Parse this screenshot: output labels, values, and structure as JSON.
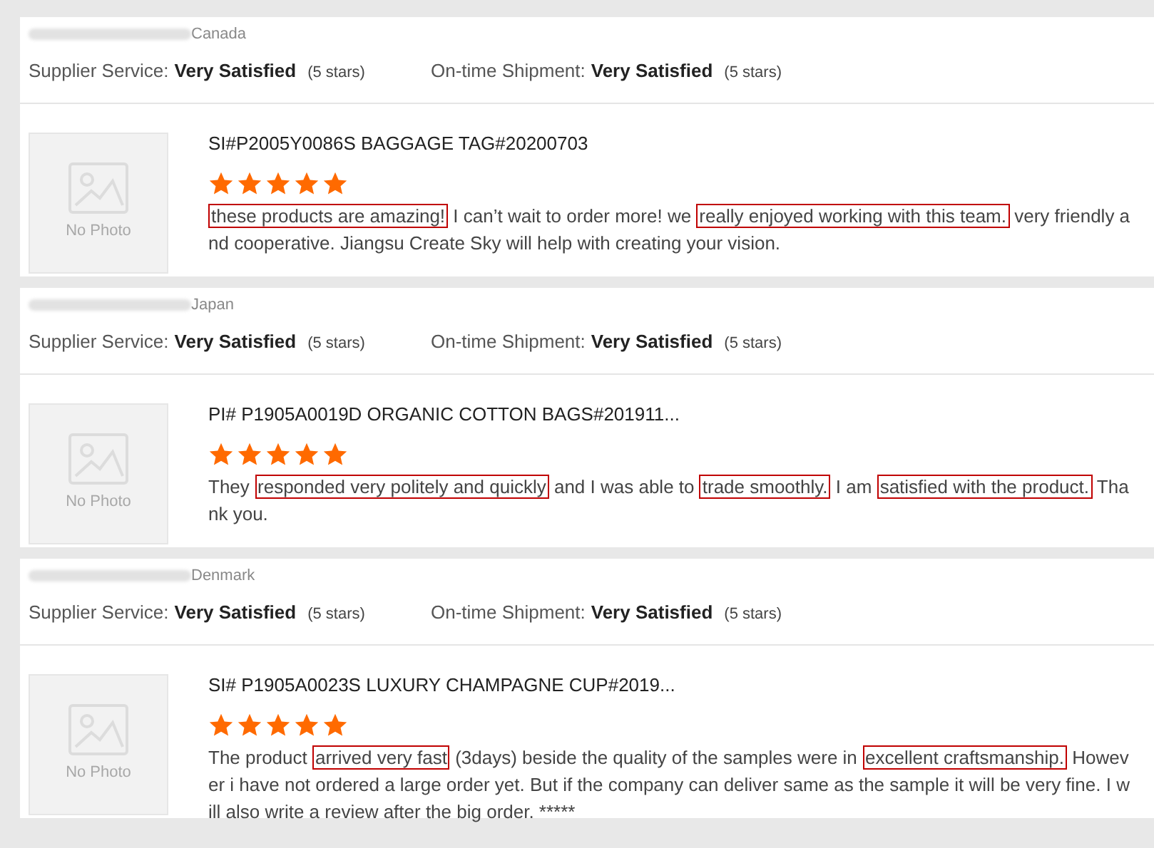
{
  "reviews": [
    {
      "country": "Canada",
      "ratings": [
        {
          "label": "Supplier Service:",
          "value": "Very Satisfied",
          "stars_text": "(5 stars)"
        },
        {
          "label": "On-time Shipment:",
          "value": "Very Satisfied",
          "stars_text": "(5 stars)"
        }
      ],
      "photo_text": "No Photo",
      "product": "SI#P2005Y0086S BAGGAGE TAG#20200703",
      "stars": 5,
      "text": [
        {
          "s": "these products are amazing!",
          "boxed": true
        },
        {
          "s": " I can’t wait to order more! we ",
          "boxed": false
        },
        {
          "s": "really enjoyed working with this team.",
          "boxed": true
        },
        {
          "s": " very friendly and cooperative. Jiangsu Create Sky will help with creating your vision.",
          "boxed": false
        }
      ]
    },
    {
      "country": "Japan",
      "ratings": [
        {
          "label": "Supplier Service:",
          "value": "Very Satisfied",
          "stars_text": "(5 stars)"
        },
        {
          "label": "On-time Shipment:",
          "value": "Very Satisfied",
          "stars_text": "(5 stars)"
        }
      ],
      "photo_text": "No Photo",
      "product": "PI# P1905A0019D ORGANIC COTTON BAGS#201911...",
      "stars": 5,
      "text": [
        {
          "s": "They ",
          "boxed": false
        },
        {
          "s": "responded very politely and quickly",
          "boxed": true
        },
        {
          "s": " and I was able to ",
          "boxed": false
        },
        {
          "s": "trade smoothly.",
          "boxed": true
        },
        {
          "s": " I am ",
          "boxed": false
        },
        {
          "s": "satisfied with the product.",
          "boxed": true
        },
        {
          "s": " Thank you.",
          "boxed": false
        }
      ]
    },
    {
      "country": "Denmark",
      "ratings": [
        {
          "label": "Supplier Service:",
          "value": "Very Satisfied",
          "stars_text": "(5 stars)"
        },
        {
          "label": "On-time Shipment:",
          "value": "Very Satisfied",
          "stars_text": "(5 stars)"
        }
      ],
      "photo_text": "No Photo",
      "product": "SI# P1905A0023S LUXURY CHAMPAGNE CUP#2019...",
      "stars": 5,
      "text": [
        {
          "s": "The product ",
          "boxed": false
        },
        {
          "s": "arrived very fast",
          "boxed": true
        },
        {
          "s": " (3days) beside the quality of the samples were in ",
          "boxed": false
        },
        {
          "s": "excellent craftsmanship.",
          "boxed": true
        },
        {
          "s": " However i have not ordered a large order yet. But if the company can deliver same as the sample it will be very fine. I will also write a review after the big order. *****",
          "boxed": false
        }
      ]
    }
  ]
}
